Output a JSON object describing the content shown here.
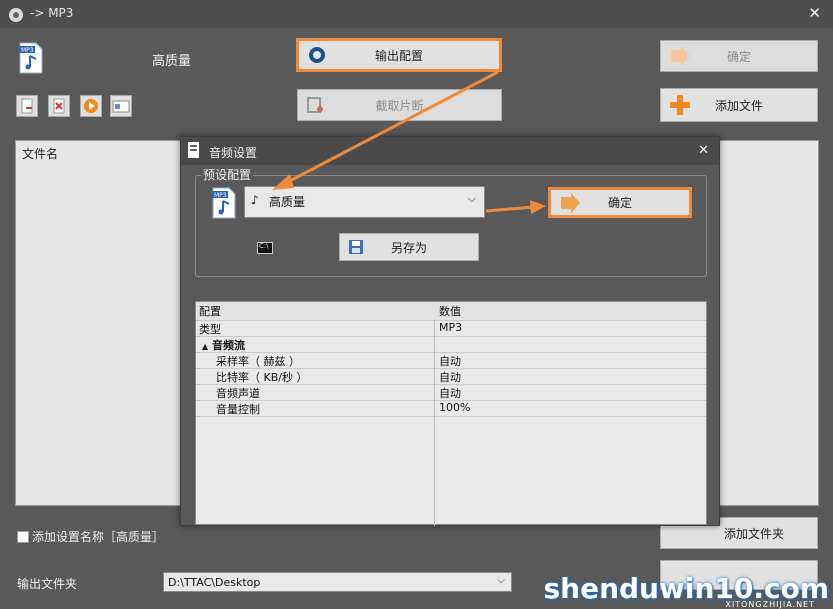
{
  "window": {
    "title": "-> MP3"
  },
  "main": {
    "quality_label": "高质量",
    "output_config_button": "输出配置",
    "clip_button": "截取片断",
    "ok_button": "确定",
    "add_file_button": "添加文件",
    "add_folder_button": "添加文件夹",
    "file_list_header": "文件名",
    "add_setting_checkbox": "添加设置名称［高质量］",
    "output_folder_label": "输出文件夹",
    "output_folder_value": "D:\\TTAC\\Desktop",
    "format_badge": "MP3"
  },
  "dialog": {
    "title": "音频设置",
    "preset_group_label": "预设配置",
    "preset_select_value": "高质量",
    "ok_button": "确定",
    "save_as_button": "另存为",
    "format_badge": "MP3",
    "grid": {
      "headers": [
        "配置",
        "数值"
      ],
      "rows": [
        {
          "name": "类型",
          "value": "MP3"
        },
        {
          "name": "音频流",
          "value": ""
        },
        {
          "name": "采样率（ 赫兹 ）",
          "value": "自动"
        },
        {
          "name": "比特率（ KB/秒 ）",
          "value": "自动"
        },
        {
          "name": "音频声道",
          "value": "自动"
        },
        {
          "name": "音量控制",
          "value": "100%"
        }
      ]
    }
  },
  "watermark": {
    "main": "shenduwin10.com",
    "sub": "XITONGZHIJIA.NET"
  },
  "colors": {
    "accent": "#ef8a3b",
    "background": "#595959"
  }
}
